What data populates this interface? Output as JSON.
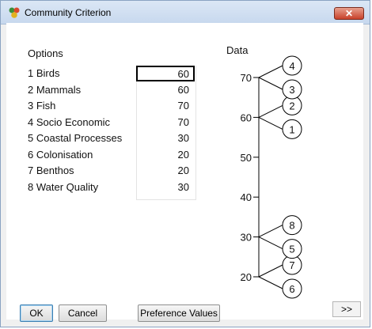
{
  "window": {
    "title": "Community Criterion",
    "close_label": "✕"
  },
  "options_label": "Options",
  "data_label": "Data",
  "options": [
    {
      "label": "1 Birds",
      "value": "60"
    },
    {
      "label": "2 Mammals",
      "value": "60"
    },
    {
      "label": "3 Fish",
      "value": "70"
    },
    {
      "label": "4 Socio Economic",
      "value": "70"
    },
    {
      "label": "5 Coastal Processes",
      "value": "30"
    },
    {
      "label": "6 Colonisation",
      "value": "20"
    },
    {
      "label": "7 Benthos",
      "value": "20"
    },
    {
      "label": "8 Water Quality",
      "value": "30"
    }
  ],
  "chart_data": {
    "type": "scatter",
    "ylim": [
      20,
      70
    ],
    "y_ticks": [
      70,
      60,
      50,
      40,
      30,
      20
    ],
    "points": [
      {
        "label": "4",
        "y": 70
      },
      {
        "label": "3",
        "y": 70
      },
      {
        "label": "2",
        "y": 60
      },
      {
        "label": "1",
        "y": 60
      },
      {
        "label": "8",
        "y": 30
      },
      {
        "label": "5",
        "y": 30
      },
      {
        "label": "7",
        "y": 20
      },
      {
        "label": "6",
        "y": 20
      }
    ]
  },
  "buttons": {
    "ok": "OK",
    "cancel": "Cancel",
    "preference": "Preference Values",
    "more": ">>"
  }
}
